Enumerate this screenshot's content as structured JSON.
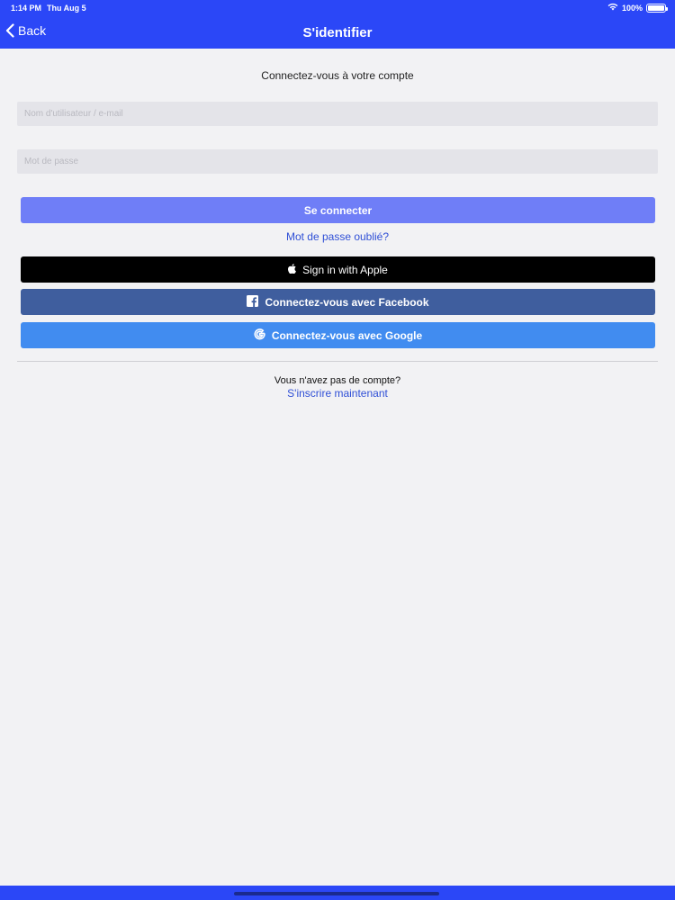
{
  "status_bar": {
    "time": "1:14 PM",
    "date": "Thu Aug 5",
    "battery": "100%",
    "battery_level": 1.0
  },
  "nav": {
    "back_label": "Back",
    "title": "S'identifier"
  },
  "login": {
    "subtitle": "Connectez-vous à votre compte",
    "username_placeholder": "Nom d'utilisateur / e-mail",
    "password_placeholder": "Mot de passe",
    "submit_label": "Se connecter",
    "forgot_label": "Mot de passe oublié?"
  },
  "social": {
    "apple_label": "Sign in with Apple",
    "facebook_label": "Connectez-vous avec Facebook",
    "google_label": "Connectez-vous avec Google"
  },
  "signup": {
    "prompt": "Vous n'avez pas de compte?",
    "link_label": "S'inscrire maintenant"
  },
  "colors": {
    "header": "#2b47f7",
    "login_button": "#6f7ef7",
    "apple_button": "#000000",
    "facebook_button": "#3f5e9e",
    "google_button": "#418cf0",
    "link": "#2f4fd6"
  }
}
